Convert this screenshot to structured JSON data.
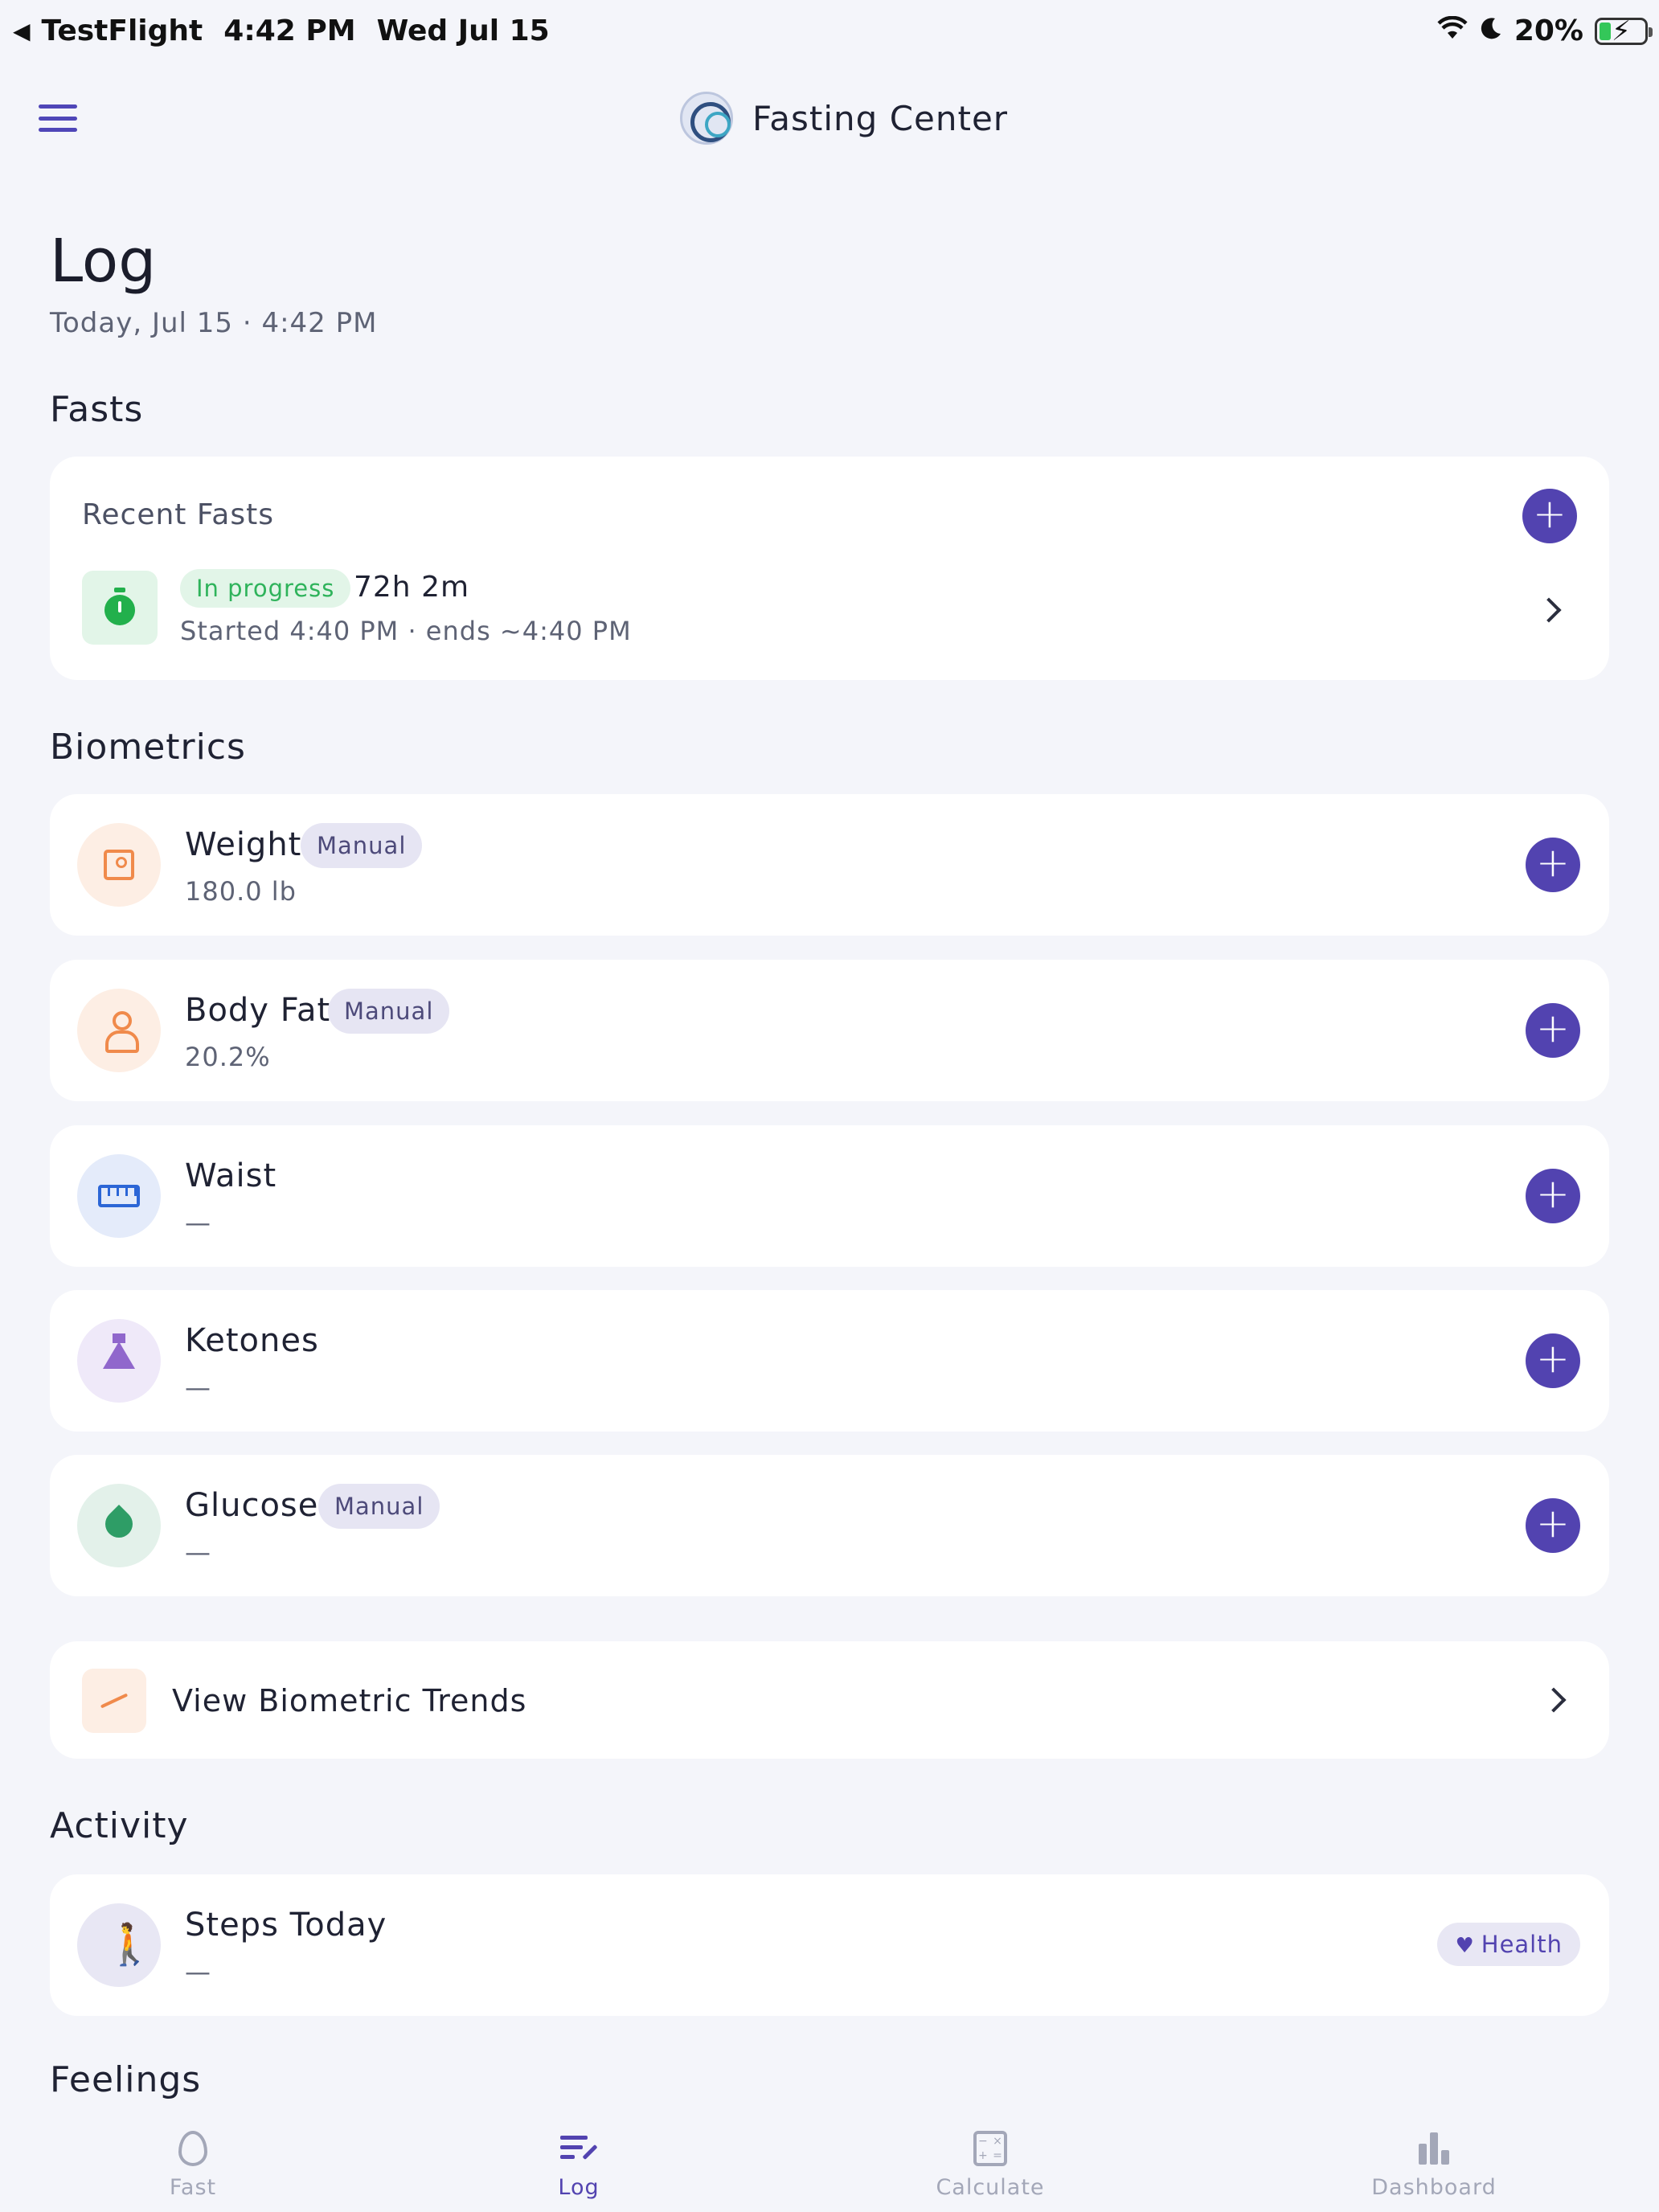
{
  "status_bar": {
    "back_app": "TestFlight",
    "time": "4:42 PM",
    "date": "Wed Jul 15",
    "battery": "20%",
    "battery_level": 0.2
  },
  "nav": {
    "title": "Fasting Center"
  },
  "header": {
    "title": "Log",
    "subtitle": "Today, Jul 15 · 4:42 PM"
  },
  "fasts": {
    "section_title": "Fasts",
    "card_title": "Recent Fasts",
    "item": {
      "status": "In progress",
      "duration": "72h 2m",
      "meta": "Started 4:40 PM · ends ~4:40 PM"
    }
  },
  "biometrics": {
    "section_title": "Biometrics",
    "items": [
      {
        "name": "Weight",
        "badge": "Manual",
        "value": "180.0 lb",
        "icon": "scale-icon"
      },
      {
        "name": "Body Fat",
        "badge": "Manual",
        "value": "20.2%",
        "icon": "person-icon"
      },
      {
        "name": "Waist",
        "value": "—",
        "icon": "ruler-icon"
      },
      {
        "name": "Ketones",
        "value": "—",
        "icon": "flask-icon"
      },
      {
        "name": "Glucose",
        "badge": "Manual",
        "value": "—",
        "icon": "drop-icon"
      }
    ],
    "trends_label": "View Biometric Trends"
  },
  "activity": {
    "section_title": "Activity",
    "steps_label": "Steps Today",
    "steps_value": "—",
    "source_badge": "Health"
  },
  "feelings": {
    "section_title": "Feelings"
  },
  "tabs": [
    {
      "label": "Fast",
      "icon": "flame-icon"
    },
    {
      "label": "Log",
      "icon": "log-icon"
    },
    {
      "label": "Calculate",
      "icon": "calculator-icon"
    },
    {
      "label": "Dashboard",
      "icon": "bar-chart-icon"
    }
  ],
  "colors": {
    "accent": "#5243b0",
    "background": "#f4f5fa",
    "success": "#22b04c",
    "orange": "#f08a4b"
  }
}
